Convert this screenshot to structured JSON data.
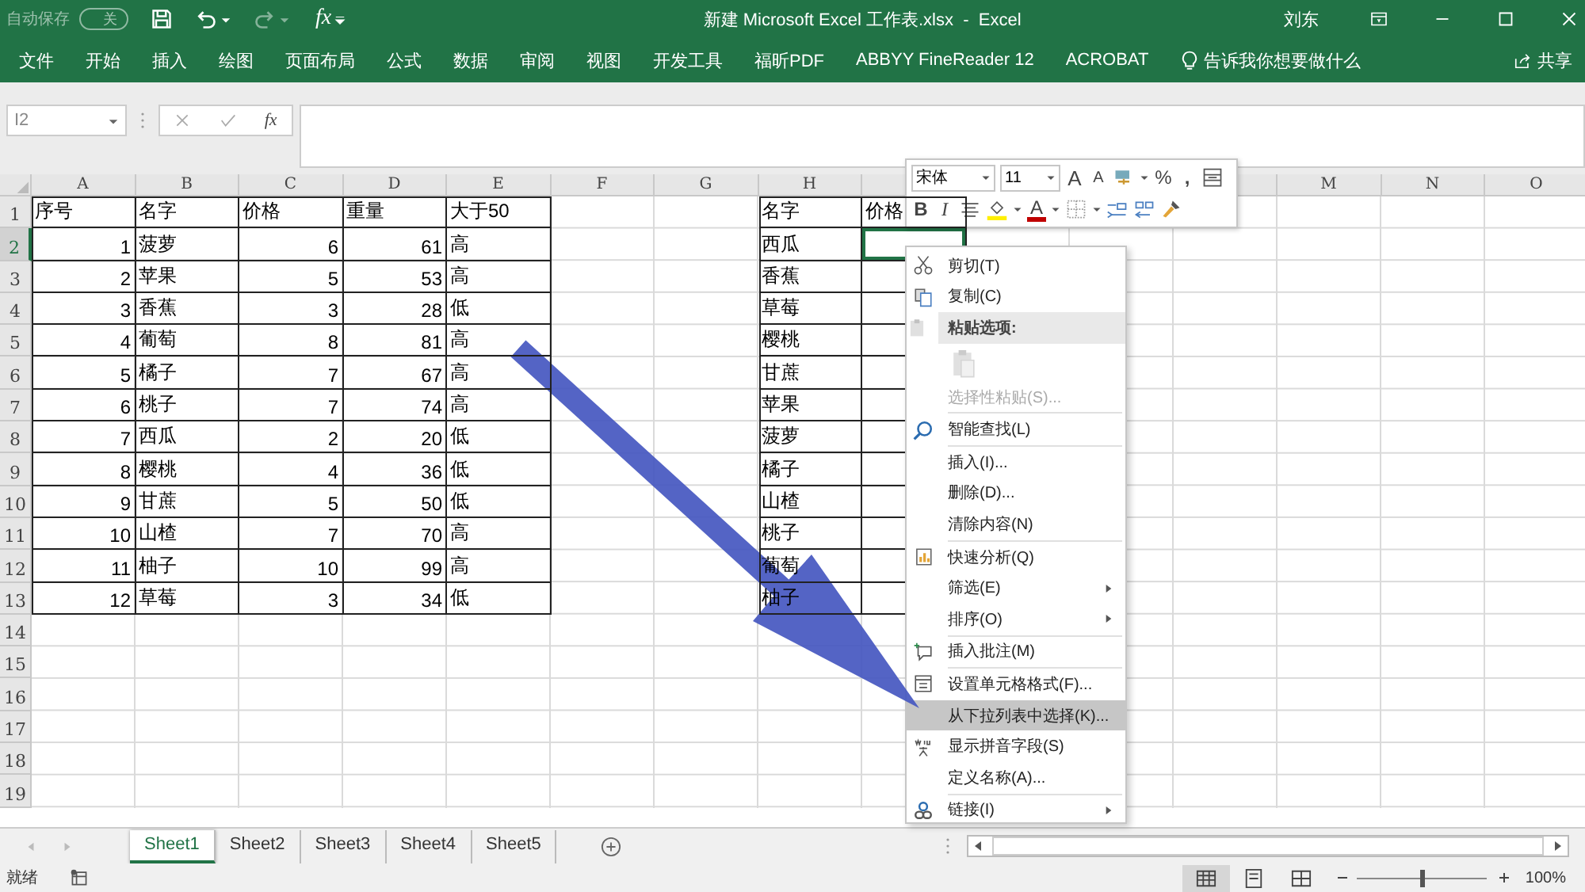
{
  "title_bar": {
    "autosave": "自动保存",
    "autosave_state": "关",
    "fx": "fx",
    "title": "新建 Microsoft Excel 工作表.xlsx  -  Excel",
    "user": "刘东"
  },
  "ribbon_tabs": [
    "文件",
    "开始",
    "插入",
    "绘图",
    "页面布局",
    "公式",
    "数据",
    "审阅",
    "视图",
    "开发工具",
    "福昕PDF",
    "ABBYY FineReader 12",
    "ACROBAT"
  ],
  "tell_me": "告诉我你想要做什么",
  "share": "共享",
  "formula_bar": {
    "name_box": "I2",
    "fx": "fx"
  },
  "sheet": {
    "columns_left": [
      "A",
      "B",
      "C",
      "D",
      "E",
      "F",
      "G",
      "H"
    ],
    "columns_right": [
      "M",
      "N",
      "O"
    ],
    "row_numbers": [
      "1",
      "2",
      "3",
      "4",
      "5",
      "6",
      "7",
      "8",
      "9",
      "10",
      "11",
      "12",
      "13",
      "14",
      "15",
      "16",
      "17",
      "18",
      "19"
    ],
    "rows": [
      {
        "cells": [
          "序号",
          "名字",
          "价格",
          "重量",
          "大于50"
        ]
      },
      {
        "cells": [
          "1",
          "菠萝",
          "6",
          "61",
          "高"
        ]
      },
      {
        "cells": [
          "2",
          "苹果",
          "5",
          "53",
          "高"
        ]
      },
      {
        "cells": [
          "3",
          "香蕉",
          "3",
          "28",
          "低"
        ]
      },
      {
        "cells": [
          "4",
          "葡萄",
          "8",
          "81",
          "高"
        ]
      },
      {
        "cells": [
          "5",
          "橘子",
          "7",
          "67",
          "高"
        ]
      },
      {
        "cells": [
          "6",
          "桃子",
          "7",
          "74",
          "高"
        ]
      },
      {
        "cells": [
          "7",
          "西瓜",
          "2",
          "20",
          "低"
        ]
      },
      {
        "cells": [
          "8",
          "樱桃",
          "4",
          "36",
          "低"
        ]
      },
      {
        "cells": [
          "9",
          "甘蔗",
          "5",
          "50",
          "低"
        ]
      },
      {
        "cells": [
          "10",
          "山楂",
          "7",
          "70",
          "高"
        ]
      },
      {
        "cells": [
          "11",
          "柚子",
          "10",
          "99",
          "高"
        ]
      },
      {
        "cells": [
          "12",
          "草莓",
          "3",
          "34",
          "低"
        ]
      }
    ],
    "lookup_rows": [
      {
        "name": "名字",
        "price": "价格",
        "selected": false
      },
      {
        "name": "西瓜",
        "selected": true
      },
      {
        "name": "香蕉",
        "selected": false
      },
      {
        "name": "草莓",
        "selected": false
      },
      {
        "name": "樱桃",
        "selected": false
      },
      {
        "name": "甘蔗",
        "selected": false
      },
      {
        "name": "苹果",
        "selected": false
      },
      {
        "name": "菠萝",
        "selected": false
      },
      {
        "name": "橘子",
        "selected": false
      },
      {
        "name": "山楂",
        "selected": false
      },
      {
        "name": "桃子",
        "selected": false
      },
      {
        "name": "葡萄",
        "selected": false
      },
      {
        "name": "柚子",
        "selected": false
      }
    ]
  },
  "mini_toolbar": {
    "font": "宋体",
    "size": "11",
    "grow": "A",
    "shrink": "A",
    "percent": "%",
    "comma": ",",
    "bold": "B",
    "italic": "I",
    "font_color": "A"
  },
  "context_menu": {
    "items": [
      {
        "kind": "command",
        "label": "剪切(T)",
        "disabled": false,
        "selected": false,
        "submenu": false
      },
      {
        "kind": "command",
        "label": "复制(C)",
        "disabled": false,
        "selected": false,
        "submenu": false
      },
      {
        "kind": "header",
        "label": "粘贴选项:"
      },
      {
        "kind": "paste-option",
        "disabled": true
      },
      {
        "kind": "command",
        "label": "选择性粘贴(S)...",
        "disabled": true,
        "selected": false,
        "submenu": false
      },
      {
        "kind": "separator"
      },
      {
        "kind": "command",
        "label": "智能查找(L)",
        "disabled": false,
        "selected": false,
        "submenu": false
      },
      {
        "kind": "separator"
      },
      {
        "kind": "command",
        "label": "插入(I)...",
        "disabled": false,
        "selected": false,
        "submenu": false
      },
      {
        "kind": "command",
        "label": "删除(D)...",
        "disabled": false,
        "selected": false,
        "submenu": false
      },
      {
        "kind": "command",
        "label": "清除内容(N)",
        "disabled": false,
        "selected": false,
        "submenu": false
      },
      {
        "kind": "separator"
      },
      {
        "kind": "command",
        "label": "快速分析(Q)",
        "disabled": false,
        "selected": false,
        "submenu": false
      },
      {
        "kind": "command",
        "label": "筛选(E)",
        "disabled": false,
        "selected": false,
        "submenu": true
      },
      {
        "kind": "command",
        "label": "排序(O)",
        "disabled": false,
        "selected": false,
        "submenu": true
      },
      {
        "kind": "separator"
      },
      {
        "kind": "command",
        "label": "插入批注(M)",
        "disabled": false,
        "selected": false,
        "submenu": false
      },
      {
        "kind": "separator"
      },
      {
        "kind": "command",
        "label": "设置单元格格式(F)...",
        "disabled": false,
        "selected": false,
        "submenu": false
      },
      {
        "kind": "command",
        "label": "从下拉列表中选择(K)...",
        "disabled": false,
        "selected": true,
        "submenu": false
      },
      {
        "kind": "command",
        "label": "显示拼音字段(S)",
        "disabled": false,
        "selected": false,
        "submenu": false
      },
      {
        "kind": "command",
        "label": "定义名称(A)...",
        "disabled": false,
        "selected": false,
        "submenu": false
      },
      {
        "kind": "separator"
      },
      {
        "kind": "command",
        "label": "链接(I)",
        "disabled": false,
        "selected": false,
        "submenu": true
      }
    ]
  },
  "sheet_tabs": [
    {
      "label": "Sheet1",
      "selected": true
    },
    {
      "label": "Sheet2",
      "selected": false
    },
    {
      "label": "Sheet3",
      "selected": false
    },
    {
      "label": "Sheet4",
      "selected": false
    },
    {
      "label": "Sheet5",
      "selected": false
    }
  ],
  "status_bar": {
    "status": "就绪",
    "zoom": "100%",
    "zoom_slider": {
      "level": 0.5
    }
  }
}
